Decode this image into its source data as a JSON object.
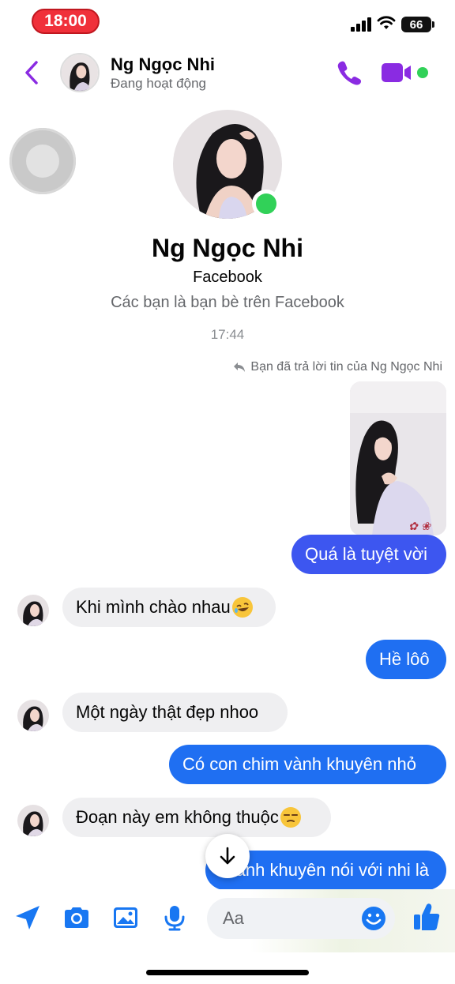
{
  "status_bar": {
    "time": "18:00",
    "battery": "66"
  },
  "header": {
    "name": "Ng Ngọc Nhi",
    "status": "Đang hoạt động",
    "accent_color": "#8a2be2"
  },
  "profile": {
    "name": "Ng Ngọc Nhi",
    "subtitle": "Facebook",
    "friends_note": "Các bạn là bạn bè trên Facebook"
  },
  "conversation": {
    "timestamp": "17:44",
    "reply_note": "Bạn đã trả lời tin của Ng Ngọc Nhi",
    "messages": [
      {
        "from": "me",
        "text": "Quá là tuyệt vời"
      },
      {
        "from": "them",
        "text": "Khi mình chào nhau",
        "emoji": "rolling-laughing"
      },
      {
        "from": "me",
        "text": "Hề lôô"
      },
      {
        "from": "them",
        "text": "Một ngày thật đẹp nhoo"
      },
      {
        "from": "me",
        "text": "Có con chim vành khuyên nhỏ"
      },
      {
        "from": "them",
        "text": "Đoạn này em không thuộc",
        "emoji": "unamused"
      },
      {
        "from": "me",
        "text": "Vành khuyên nói với nhi là"
      }
    ]
  },
  "composer": {
    "placeholder": "Aa"
  },
  "colors": {
    "outgoing": "#1f6ff2",
    "incoming": "#efeff1",
    "active": "#31d158",
    "toolbar_icons": "#1877f2"
  }
}
